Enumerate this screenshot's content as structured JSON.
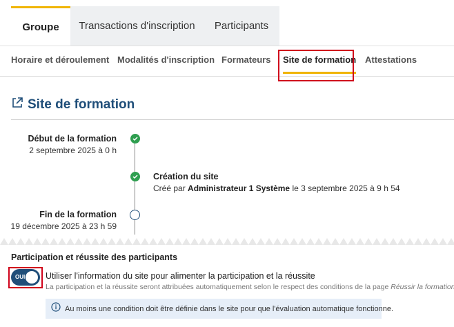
{
  "top_tabs": [
    {
      "label": "Groupe",
      "active": true
    },
    {
      "label": "Transactions d'inscription",
      "active": false
    },
    {
      "label": "Participants",
      "active": false
    }
  ],
  "sub_tabs": [
    {
      "label": "Horaire et déroulement"
    },
    {
      "label": "Modalités d'inscription"
    },
    {
      "label": "Formateurs"
    },
    {
      "label": "Site de formation",
      "active": true
    },
    {
      "label": "Attestations"
    }
  ],
  "section": {
    "title": "Site de formation",
    "icon": "external-link-icon"
  },
  "timeline": {
    "start": {
      "title": "Début de la formation",
      "date": "2 septembre 2025 à 0 h",
      "status": "done"
    },
    "creation": {
      "title": "Création du site",
      "prefix": "Créé par",
      "author": "Administrateur 1 Système",
      "suffix": "le 3 septembre 2025 à 9 h 54",
      "status": "done"
    },
    "end": {
      "title": "Fin de la formation",
      "date": "19 décembre 2025 à 23 h 59",
      "status": "todo"
    }
  },
  "participation": {
    "title": "Participation et réussite des participants",
    "toggle_label": "OUI",
    "toggle_on": true,
    "toggle_text": "Utiliser l'information du site pour alimenter la participation et la réussite",
    "help_text": "La participation et la réussite seront attribuées automatiquement selon le respect des conditions de la page",
    "help_link": "Réussir la formation",
    "info_text": "Au moins une condition doit être définie dans le site pour que l'évaluation automatique fonctionne."
  },
  "colors": {
    "accent": "#f0b400",
    "primary": "#1f4e79",
    "success": "#2e9e4f",
    "highlight": "#d0021b",
    "info_bg": "#e6eef8"
  }
}
